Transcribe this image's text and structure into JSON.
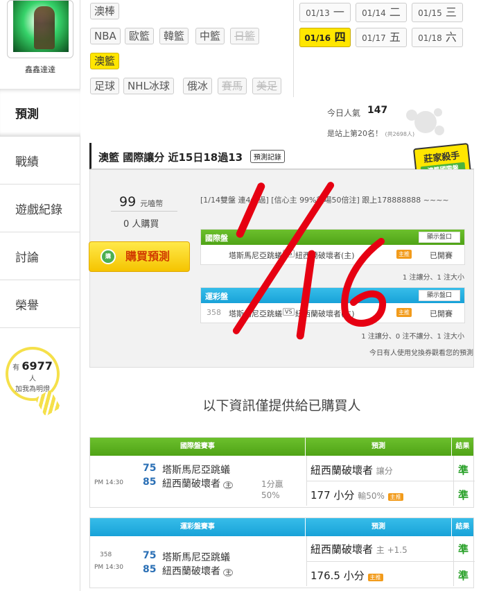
{
  "sidebar": {
    "username": "鑫鑫達達",
    "nav": [
      "預測",
      "戰績",
      "遊戲紀錄",
      "討論",
      "榮譽"
    ],
    "fans_prefix": "有",
    "fans_count": "6977",
    "fans_unit": "人",
    "fans_caption": "加我為明燈"
  },
  "leagues": {
    "row1": [
      "澳棒"
    ],
    "row2": [
      "NBA",
      "歐籃",
      "韓籃",
      "中籃",
      "日籃"
    ],
    "row3": [
      "澳籃"
    ],
    "row4": [
      "足球",
      "NHL冰球",
      "俄冰",
      "賽馬",
      "美足"
    ]
  },
  "dates": [
    {
      "md": "01/13",
      "wd": "一"
    },
    {
      "md": "01/14",
      "wd": "二"
    },
    {
      "md": "01/15",
      "wd": "三"
    },
    {
      "md": "01/16",
      "wd": "四"
    },
    {
      "md": "01/17",
      "wd": "五"
    },
    {
      "md": "01/18",
      "wd": "六"
    }
  ],
  "popularity": {
    "label": "今日人氣",
    "value": "147",
    "rank": "是站上第20名！",
    "rank_note": "(共2698人)"
  },
  "prediction": {
    "title": "澳籃 國際讓分 近15日18過13",
    "record_btn": "預測記錄",
    "badge_main": "莊家殺手",
    "badge_sub": "澳籃國際盤",
    "price": "99",
    "price_unit": "元嗑幣",
    "buyers": "0 人購買",
    "buy_label": "購買預測",
    "description": "[1/14雙盤 連4全過] [信心主 99%貓場50倍注] 跟上178888888 ~~~~",
    "intl_header": "國際盤",
    "sport_header": "運彩盤",
    "show_btn": "顯示盤口",
    "intl_row": {
      "match": "塔斯馬尼亞跳蟻",
      "vs": "VS",
      "home": "紐西蘭破壞者(主)",
      "host_tag": "主推",
      "status": "已開賽"
    },
    "intl_note": "1 注讓分、1 注大小",
    "sport_row": {
      "num": "358",
      "match": "塔斯馬尼亞跳蟻",
      "vs": "VS",
      "home": "紐西蘭破壞者(主)",
      "host_tag": "主推",
      "status": "已開賽"
    },
    "sport_note": "1 注讓分、0 注不讓分、1 注大小",
    "footnote": "今日有人使用兌換券觀看您的預測"
  },
  "notice": "以下資訊僅提供給已購買人",
  "intl_table": {
    "headers": [
      "國際盤賽事",
      "預測",
      "結果"
    ],
    "time": "PM 14:30",
    "away_score": "75",
    "away": "塔斯馬尼亞跳蟻",
    "home_score": "85",
    "home": "紐西蘭破壞者",
    "home_tag": "主",
    "spread": "1分贏",
    "spread_pct": "50%",
    "pick1": "紐西蘭破壞者",
    "pick1_type": "讓分",
    "res1": "準",
    "pick2": "177 小分",
    "pick2_extra": "輸50%",
    "host_tag": "主推",
    "res2": "準"
  },
  "sport_table": {
    "headers": [
      "運彩盤賽事",
      "預測",
      "結果"
    ],
    "num": "358",
    "time": "PM 14:30",
    "away_score": "75",
    "away": "塔斯馬尼亞跳蟻",
    "home_score": "85",
    "home": "紐西蘭破壞者",
    "home_tag": "主",
    "pick1": "紐西蘭破壞者",
    "pick1_extra": "主 +1.5",
    "res1": "準",
    "pick2": "176.5 小分",
    "host_tag": "主推",
    "res2": "準"
  },
  "colors": {
    "accent_yellow": "#ffe600",
    "green": "#4fa316",
    "blue": "#18a2d8",
    "handwriting_red": "#e60012"
  }
}
